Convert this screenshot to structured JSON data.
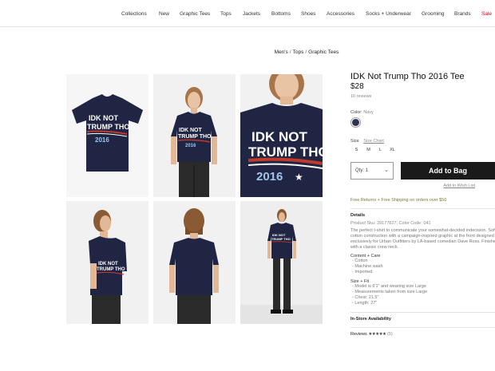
{
  "nav": {
    "items": [
      "Collections",
      "New",
      "Graphic Tees",
      "Tops",
      "Jackets",
      "Bottoms",
      "Shoes",
      "Accessories",
      "Socks + Underwear",
      "Grooming",
      "Brands",
      "Sale"
    ]
  },
  "breadcrumb": [
    "Men's",
    "Tops",
    "Graphic Tees"
  ],
  "shirt_text": [
    "IDK NOT",
    "TRUMP THO",
    "2016"
  ],
  "product": {
    "title": "IDK Not Trump Tho 2016 Tee",
    "price": "$28",
    "review_count_label": "10 reviews",
    "color_label": "Color:",
    "color_value": "Navy",
    "swatch_color": "#2c3357",
    "size_label": "Size",
    "size_chart": "Size Chart",
    "sizes": [
      "S",
      "M",
      "L",
      "XL"
    ],
    "qty_label": "Qty: 1",
    "add_to_bag": "Add to Bag",
    "wishlist": "Add to Wish List",
    "shipping": "Free Returns + Free Shipping on orders over $50",
    "details_heading": "Details",
    "sku": "Product Sku: 39177827; Color Code: 041",
    "description": "The perfect t-shirt to communicate your somewhat-decided indecision. Soft cotton construction with a campaign-inspired graphic at the front designed exclusively for Urban Outfitters by LA-based comedian Dave Ross. Finished with a classic crew neck.",
    "content_heading": "Content + Care",
    "content_items": [
      "- Cotton",
      "- Machine wash",
      "- Imported"
    ],
    "fit_heading": "Size + Fit",
    "fit_items": [
      "- Model is 6'1\" and wearing size Large",
      "- Measurements taken from size Large",
      "- Chest: 21.5\"",
      "- Length: 27\""
    ],
    "in_store": "In-Store Availability",
    "reviews_label": "Reviews",
    "stars": "★★★★★",
    "reviews_count": "(5)"
  },
  "colors": {
    "navy": "#1f2542",
    "accent_red": "#d0021b",
    "button": "#1a1a1a"
  }
}
